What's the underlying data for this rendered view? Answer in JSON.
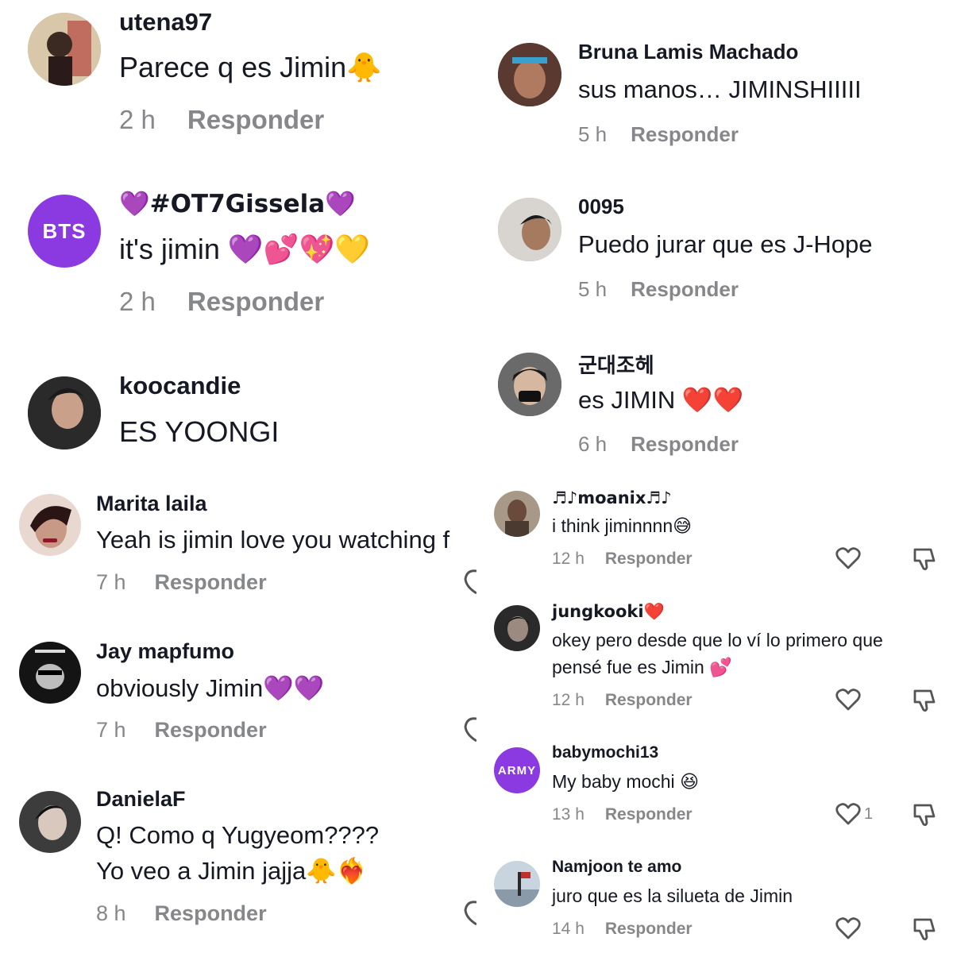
{
  "reply_label": "Responder",
  "panel1": {
    "comments": [
      {
        "user": "utena97",
        "text": "Parece q es Jimin",
        "emoji": "🐥",
        "time": "2 h",
        "avatar_color": "#c9b08a"
      },
      {
        "user": "💜#OT7Gissela💜",
        "text": "it's jimin",
        "emoji": "💜💕💖💛",
        "time": "2 h",
        "avatar_initials": "BTS",
        "avatar_color": "#8a3ae0"
      },
      {
        "user": "koocandie",
        "text": "ES YOONGI",
        "emoji": "",
        "time": "",
        "avatar_color": "#3a3a3a"
      }
    ]
  },
  "panel2": {
    "comments": [
      {
        "user": "Bruna Lamis Machado",
        "text": "sus manos… JIMINSHIIIII",
        "emoji": "",
        "time": "5 h",
        "avatar_color": "#6b4a3e"
      },
      {
        "user": "0095",
        "text": "Puedo jurar que es J-Hope",
        "emoji": "",
        "time": "5 h",
        "avatar_color": "#9a8f88"
      },
      {
        "user": "군대조헤",
        "text": "es JIMIN",
        "emoji": "❤️❤️",
        "time": "6 h",
        "avatar_color": "#5a5a5a"
      }
    ]
  },
  "panel3": {
    "comments": [
      {
        "user": "Marita laila",
        "text": "Yeah is jimin love you watching f",
        "emoji": "",
        "time": "7 h",
        "avatar_color": "#7a3a3a"
      },
      {
        "user": "Jay mapfumo",
        "text": "obviously Jimin",
        "emoji": "💜💜",
        "time": "7 h",
        "avatar_color": "#2a2a2a"
      },
      {
        "user": "DanielaF",
        "text": "Q! Como q Yugyeom????",
        "text2": "Yo veo a Jimin jajja",
        "emoji": "🐥❤️‍🔥",
        "time": "8 h",
        "avatar_color": "#3c3c3c"
      }
    ]
  },
  "panel4": {
    "comments": [
      {
        "user": "♬♪moanix♬♪",
        "text": "i think jiminnnn",
        "emoji": "😅",
        "time": "12 h",
        "likes": "",
        "avatar_color": "#8c7d72"
      },
      {
        "user": "jungkooki❤️",
        "text": "okey pero desde que lo ví lo primero que",
        "text2": "pensé fue es Jimin",
        "emoji": "💕",
        "time": "12 h",
        "likes": "",
        "avatar_color": "#333333"
      },
      {
        "user": "babymochi13",
        "text": "My baby mochi",
        "emoji": "😆",
        "time": "13 h",
        "likes": "1",
        "avatar_initials": "ARMY",
        "avatar_color": "#8a3ae0"
      },
      {
        "user": "Namjoon te amo",
        "text": "juro que es la silueta de Jimin",
        "emoji": "",
        "time": "14 h",
        "likes": "",
        "avatar_color": "#9aa6b0"
      }
    ]
  }
}
